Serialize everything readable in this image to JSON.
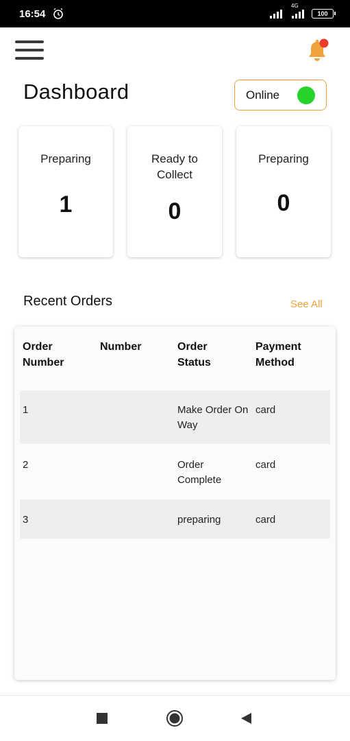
{
  "status_bar": {
    "time": "16:54",
    "battery": "100",
    "network": "4G"
  },
  "header": {
    "menu_icon": "hamburger-menu-icon",
    "bell_icon": "notification-bell-icon",
    "title": "Dashboard"
  },
  "online_toggle": {
    "label": "Online",
    "state": "on"
  },
  "stats": [
    {
      "label": "Preparing",
      "value": "1"
    },
    {
      "label": "Ready to Collect",
      "value": "0"
    },
    {
      "label": "Preparing",
      "value": "0"
    }
  ],
  "recent_orders": {
    "title": "Recent Orders",
    "see_all": "See All",
    "columns": [
      "Order Number",
      "Number",
      "Order Status",
      "Payment Method"
    ],
    "rows": [
      {
        "order_number": "1",
        "number": "",
        "status": "Make Order On Way",
        "payment": "card"
      },
      {
        "order_number": "2",
        "number": "",
        "status": "Order Complete",
        "payment": "card"
      },
      {
        "order_number": "3",
        "number": "",
        "status": "preparing",
        "payment": "card"
      }
    ]
  },
  "colors": {
    "accent": "#f0a23c",
    "online": "#25d32a",
    "notification_dot": "#ef3b2c"
  },
  "nav_icons": [
    "recents-square-icon",
    "home-circle-icon",
    "back-triangle-icon"
  ]
}
